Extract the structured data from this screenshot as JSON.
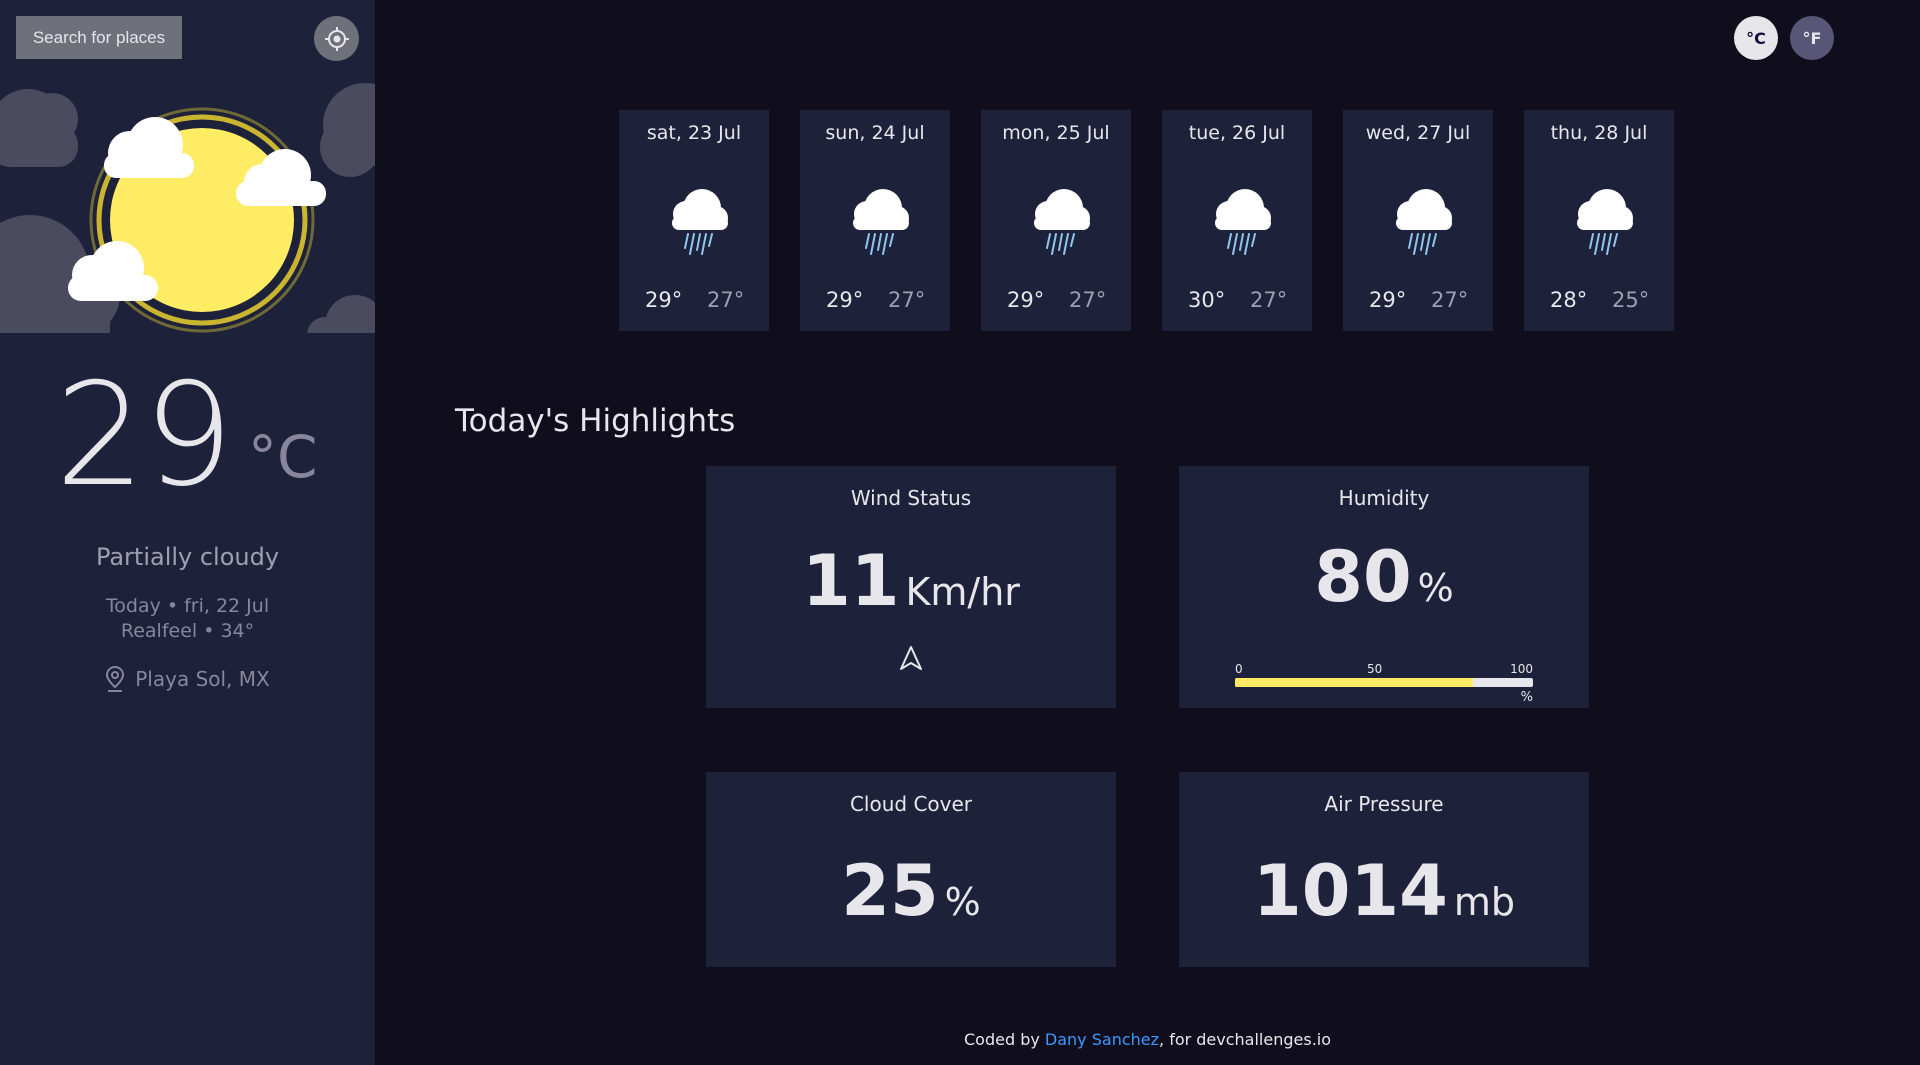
{
  "sidebar": {
    "search_label": "Search for places",
    "current": {
      "temperature": "29",
      "unit": "°C",
      "condition": "Partially cloudy",
      "date_line": "Today • fri, 22 Jul",
      "realfeel_line": "Realfeel • 34°",
      "location": "Playa Sol, MX"
    },
    "icons": {
      "locate": "crosshair-icon",
      "location": "map-pin-icon",
      "hero": "partly-cloudy-sun-illustration"
    }
  },
  "units": {
    "celsius_label": "°C",
    "fahrenheit_label": "°F",
    "selected": "celsius"
  },
  "forecast": [
    {
      "date": "sat, 23 Jul",
      "max": "29°",
      "min": "27°",
      "icon": "rain-cloud-icon"
    },
    {
      "date": "sun, 24 Jul",
      "max": "29°",
      "min": "27°",
      "icon": "rain-cloud-icon"
    },
    {
      "date": "mon, 25 Jul",
      "max": "29°",
      "min": "27°",
      "icon": "rain-cloud-icon"
    },
    {
      "date": "tue, 26 Jul",
      "max": "30°",
      "min": "27°",
      "icon": "rain-cloud-icon"
    },
    {
      "date": "wed, 27 Jul",
      "max": "29°",
      "min": "27°",
      "icon": "rain-cloud-icon"
    },
    {
      "date": "thu, 28 Jul",
      "max": "28°",
      "min": "25°",
      "icon": "rain-cloud-icon"
    }
  ],
  "highlights": {
    "title": "Today's Highlights",
    "wind": {
      "label": "Wind Status",
      "value": "11",
      "unit": "Km/hr",
      "icon": "navigation-arrow-icon"
    },
    "humidity": {
      "label": "Humidity",
      "value": "80",
      "unit": "%",
      "percent": 80,
      "scale": {
        "min": "0",
        "mid": "50",
        "max": "100",
        "unit": "%"
      }
    },
    "cloud_cover": {
      "label": "Cloud Cover",
      "value": "25",
      "unit": "%"
    },
    "air_pressure": {
      "label": "Air Pressure",
      "value": "1014",
      "unit": "mb"
    }
  },
  "footer": {
    "prefix": "Coded by",
    "author": "Dany Sanchez",
    "suffix": ", for devchallenges.io"
  },
  "colors": {
    "background": "#100e1d",
    "panel": "#1e213a",
    "accent_yellow": "#ffec65",
    "link_blue": "#3c98ff"
  }
}
